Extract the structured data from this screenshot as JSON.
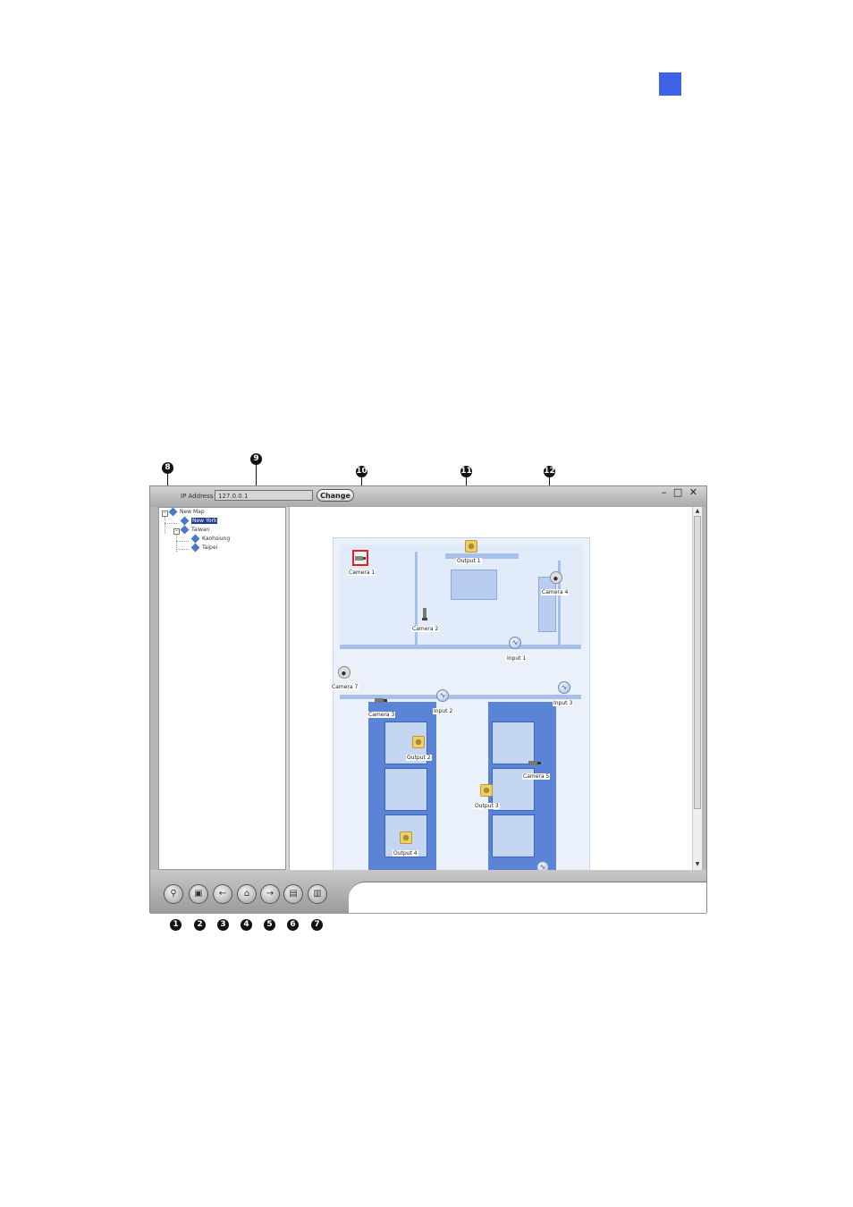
{
  "window": {
    "ip_label": "IP Address",
    "ip_value": "127.0.0.1",
    "change_label": "Change",
    "win_controls": "– □ ✕"
  },
  "tree": {
    "items": [
      {
        "label": "New Map"
      },
      {
        "label": "New York"
      },
      {
        "label": "Taiwan"
      },
      {
        "label": "Kaohsiung"
      },
      {
        "label": "Taipei"
      }
    ]
  },
  "map": {
    "devices": [
      {
        "label": "Camera 1"
      },
      {
        "label": "Output 1"
      },
      {
        "label": "Camera 4"
      },
      {
        "label": "Camera 2"
      },
      {
        "label": "Input 1"
      },
      {
        "label": "Camera 7"
      },
      {
        "label": "Camera 3"
      },
      {
        "label": "Input 2"
      },
      {
        "label": "Input 3"
      },
      {
        "label": "Output 2"
      },
      {
        "label": "Camera 5"
      },
      {
        "label": "Output 3"
      },
      {
        "label": "Output 4"
      }
    ]
  },
  "toolbar": {
    "buttons": [
      {
        "icon": "search-icon",
        "glyph": "⚲"
      },
      {
        "icon": "lock-icon",
        "glyph": "▣"
      },
      {
        "icon": "back-arrow-icon",
        "glyph": "←"
      },
      {
        "icon": "home-icon",
        "glyph": "⌂"
      },
      {
        "icon": "forward-arrow-icon",
        "glyph": "→"
      },
      {
        "icon": "map-edit-icon",
        "glyph": "▤"
      },
      {
        "icon": "panel-icon",
        "glyph": "▥"
      }
    ]
  },
  "callouts": [
    "1",
    "2",
    "3",
    "4",
    "5",
    "6",
    "7",
    "8",
    "9",
    "10",
    "11",
    "12"
  ],
  "colors": {
    "accent_tab": "#3f63e6",
    "floor_plan": "#5b84d6",
    "selection": "#1f3d8c"
  }
}
